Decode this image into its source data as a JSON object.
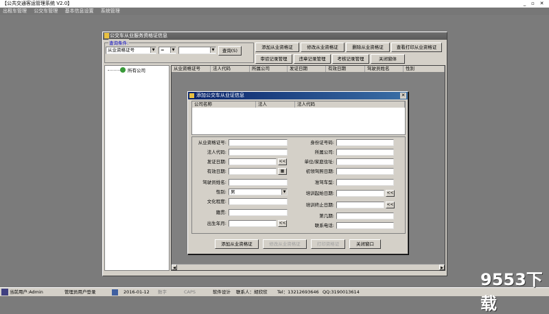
{
  "app": {
    "title": "【公共交通客运管理系统 V2.0】",
    "menu": [
      "出租车管理",
      "公交车管理",
      "基本信息设置",
      "系统管理"
    ]
  },
  "window": {
    "title": "公交车从业服务资格证信息",
    "query": {
      "legend": "查询条件:",
      "field_value": "从业资格证号",
      "operator_value": "=",
      "value_value": "",
      "query_button": "查询(S)"
    },
    "buttons": {
      "add": "添加从业资格证",
      "edit": "修改从业资格证",
      "delete": "删除从业资格证",
      "print": "查看打印从业资格证",
      "review": "审验记录管理",
      "violation": "违章记录管理",
      "exam": "考核记录管理",
      "close": "关闭窗体"
    },
    "tree_root": "所有公司",
    "columns": [
      "从业资格证号",
      "法人代码",
      "所属公司",
      "发证日期",
      "有效日期",
      "驾驶员姓名",
      "性别"
    ]
  },
  "dialog": {
    "title": "添加公交车从业证信息",
    "company_columns": [
      "公司名称",
      "法人",
      "法人代码"
    ],
    "left_fields": [
      {
        "label": "从业资格证号:",
        "value": ""
      },
      {
        "label": "法人代码:",
        "value": ""
      },
      {
        "label": "发证日期:",
        "value": ""
      },
      {
        "label": "有效日期:",
        "value": ""
      },
      {
        "label": "驾驶员姓名:",
        "value": ""
      },
      {
        "label": "性别:",
        "value": "男"
      },
      {
        "label": "文化程度:",
        "value": ""
      },
      {
        "label": "籍贯:",
        "value": ""
      },
      {
        "label": "出生年月:",
        "value": ""
      }
    ],
    "right_fields": [
      {
        "label": "身份证号码:",
        "value": ""
      },
      {
        "label": "所属公司:",
        "value": ""
      },
      {
        "label": "单位/家庭住址:",
        "value": ""
      },
      {
        "label": "初领驾照日期:",
        "value": ""
      },
      {
        "label": "准驾车型:",
        "value": ""
      },
      {
        "label": "培训起始日期:",
        "value": ""
      },
      {
        "label": "培训终止日期:",
        "value": ""
      },
      {
        "label": "第几期:",
        "value": ""
      },
      {
        "label": "联系电话:",
        "value": ""
      }
    ],
    "date_button": "<<",
    "buttons": {
      "add": "添加从业资格证",
      "edit": "修改从业资格证",
      "print": "打印资格证",
      "close": "关闭窗口"
    }
  },
  "status": {
    "user": "当前用户:Admin",
    "role": "管理员用户登录",
    "date": "2016-01-12",
    "num": "数字",
    "caps": "CAPS",
    "design": "软件设计",
    "contact": "联系人：胡欣欣",
    "tel": "Tel：13212693646",
    "qq": "QQ:3190013614"
  },
  "watermark": "9553下载"
}
